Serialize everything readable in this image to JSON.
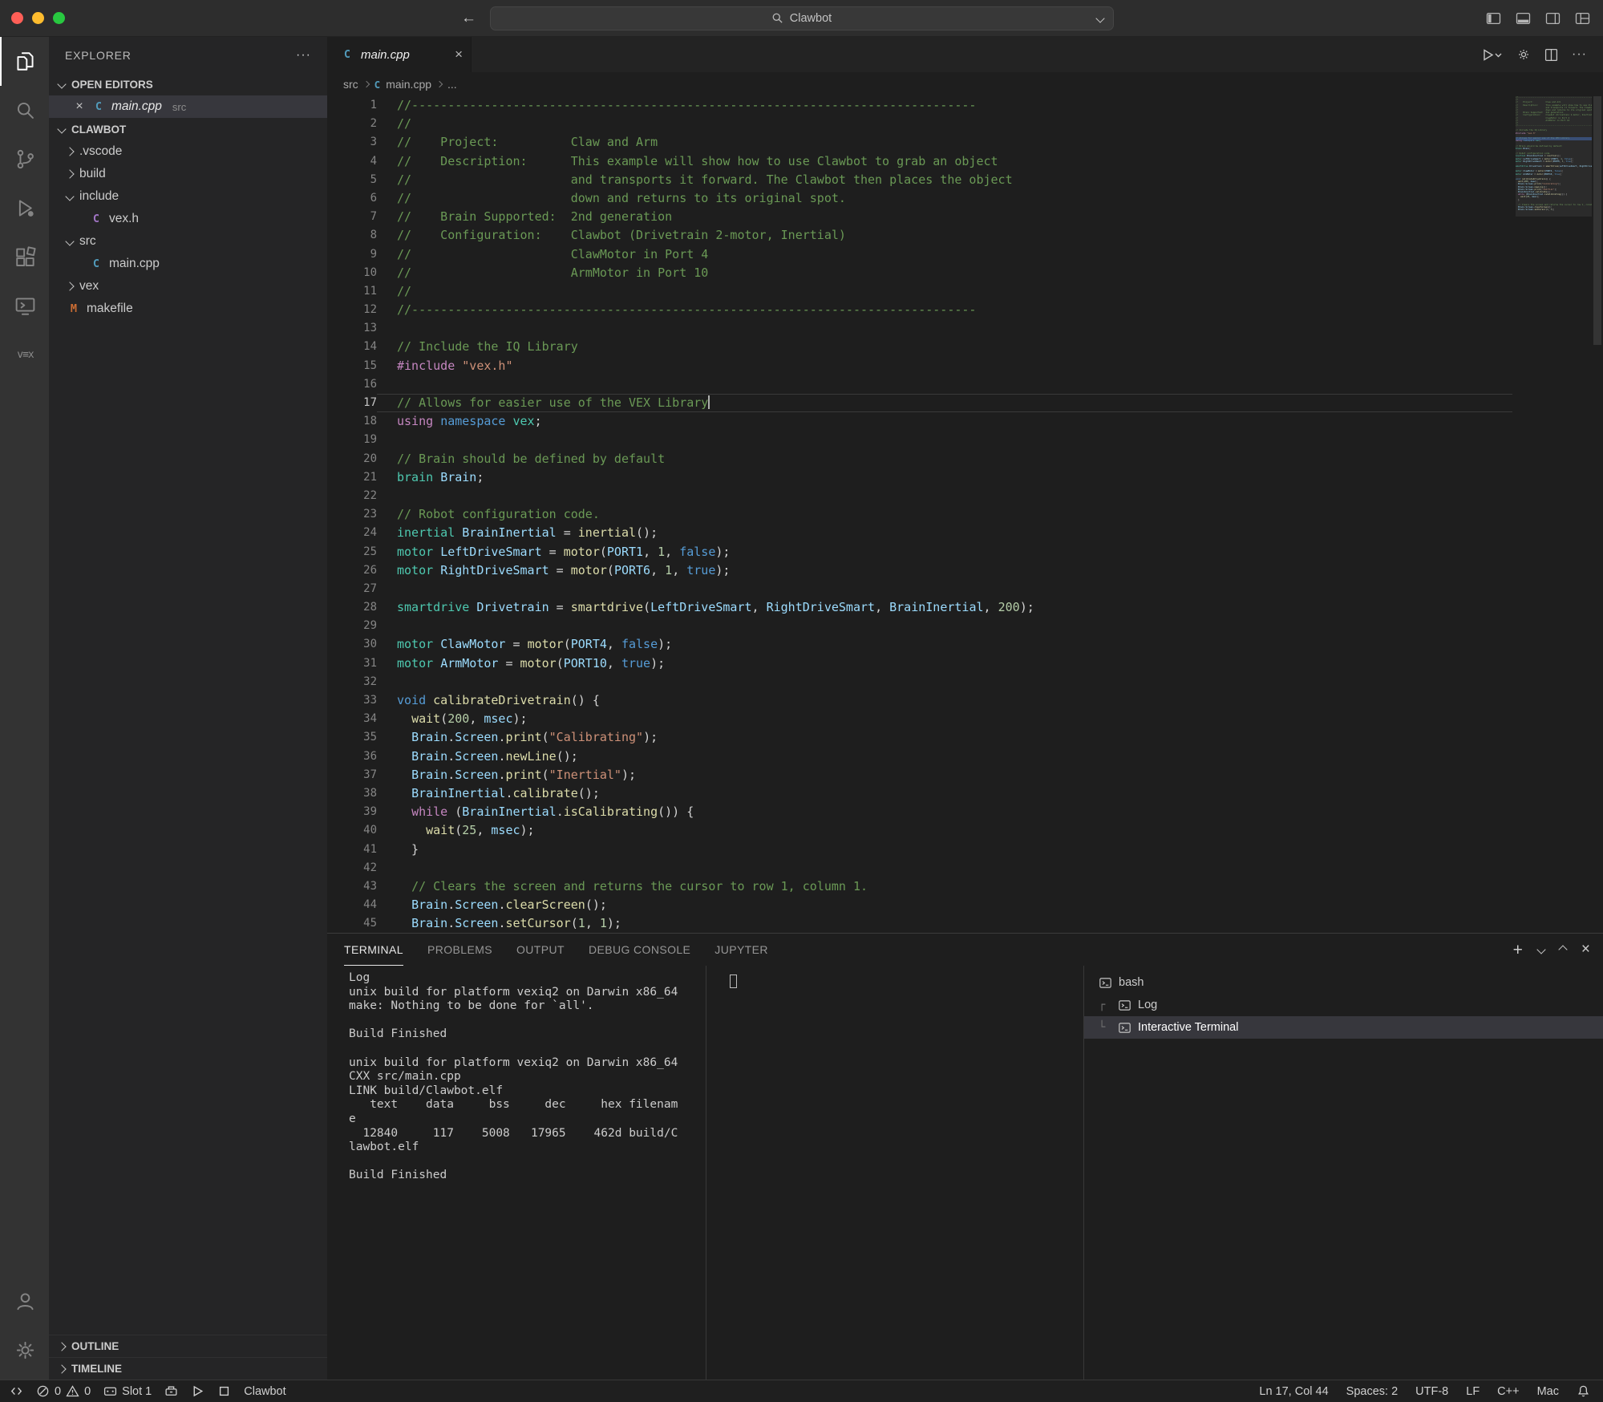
{
  "titlebar": {
    "search_value": "Clawbot",
    "back_glyph": "←",
    "forward_glyph": "→"
  },
  "activity_bar": {
    "top": [
      "explorer",
      "search",
      "source-control",
      "run-debug",
      "extensions",
      "remote-explorer",
      "vex"
    ],
    "bottom": [
      "accounts",
      "settings"
    ],
    "active": "explorer"
  },
  "sidebar": {
    "title": "EXPLORER",
    "open_editors_label": "OPEN EDITORS",
    "open_editor": {
      "file": "main.cpp",
      "path": "src"
    },
    "project_label": "CLAWBOT",
    "tree": [
      {
        "label": ".vscode",
        "depth": 0,
        "chevron": "right",
        "icon": null
      },
      {
        "label": "build",
        "depth": 0,
        "chevron": "right",
        "icon": null
      },
      {
        "label": "include",
        "depth": 0,
        "chevron": "down",
        "icon": null
      },
      {
        "label": "vex.h",
        "depth": 1,
        "chevron": null,
        "icon": "ch"
      },
      {
        "label": "src",
        "depth": 0,
        "chevron": "down",
        "icon": null
      },
      {
        "label": "main.cpp",
        "depth": 1,
        "chevron": null,
        "icon": "cpp"
      },
      {
        "label": "vex",
        "depth": 0,
        "chevron": "right",
        "icon": null
      },
      {
        "label": "makefile",
        "depth": 0,
        "chevron": null,
        "icon": "mk"
      }
    ],
    "outline_label": "OUTLINE",
    "timeline_label": "TIMELINE"
  },
  "editor": {
    "tab_label": "main.cpp",
    "breadcrumb": {
      "folder": "src",
      "file": "main.cpp",
      "more": "..."
    },
    "cursor_line": 17,
    "lines": [
      [
        [
          "c",
          "//------------------------------------------------------------------------------"
        ]
      ],
      [
        [
          "c",
          "//"
        ]
      ],
      [
        [
          "c",
          "//    Project:          Claw and Arm"
        ]
      ],
      [
        [
          "c",
          "//    Description:      This example will show how to use Clawbot to grab an object"
        ]
      ],
      [
        [
          "c",
          "//                      and transports it forward. The Clawbot then places the object"
        ]
      ],
      [
        [
          "c",
          "//                      down and returns to its original spot."
        ]
      ],
      [
        [
          "c",
          "//    Brain Supported:  2nd generation"
        ]
      ],
      [
        [
          "c",
          "//    Configuration:    Clawbot (Drivetrain 2-motor, Inertial)"
        ]
      ],
      [
        [
          "c",
          "//                      ClawMotor in Port 4"
        ]
      ],
      [
        [
          "c",
          "//                      ArmMotor in Port 10"
        ]
      ],
      [
        [
          "c",
          "//"
        ]
      ],
      [
        [
          "c",
          "//------------------------------------------------------------------------------"
        ]
      ],
      [],
      [
        [
          "c",
          "// Include the IQ Library"
        ]
      ],
      [
        [
          "k",
          "#include"
        ],
        [
          "d",
          " "
        ],
        [
          "s",
          "\"vex.h\""
        ]
      ],
      [],
      [
        [
          "c",
          "// Allows for easier use of the VEX Library"
        ]
      ],
      [
        [
          "k",
          "using"
        ],
        [
          "d",
          " "
        ],
        [
          "b",
          "namespace"
        ],
        [
          "d",
          " "
        ],
        [
          "t",
          "vex"
        ],
        [
          "d",
          ";"
        ]
      ],
      [],
      [
        [
          "c",
          "// Brain should be defined by default"
        ]
      ],
      [
        [
          "t",
          "brain"
        ],
        [
          "d",
          " "
        ],
        [
          "v",
          "Brain"
        ],
        [
          "d",
          ";"
        ]
      ],
      [],
      [
        [
          "c",
          "// Robot configuration code."
        ]
      ],
      [
        [
          "t",
          "inertial"
        ],
        [
          "d",
          " "
        ],
        [
          "v",
          "BrainInertial"
        ],
        [
          "d",
          " = "
        ],
        [
          "f",
          "inertial"
        ],
        [
          "d",
          "();"
        ]
      ],
      [
        [
          "t",
          "motor"
        ],
        [
          "d",
          " "
        ],
        [
          "v",
          "LeftDriveSmart"
        ],
        [
          "d",
          " = "
        ],
        [
          "f",
          "motor"
        ],
        [
          "d",
          "("
        ],
        [
          "v",
          "PORT1"
        ],
        [
          "d",
          ", "
        ],
        [
          "n",
          "1"
        ],
        [
          "d",
          ", "
        ],
        [
          "b",
          "false"
        ],
        [
          "d",
          ");"
        ]
      ],
      [
        [
          "t",
          "motor"
        ],
        [
          "d",
          " "
        ],
        [
          "v",
          "RightDriveSmart"
        ],
        [
          "d",
          " = "
        ],
        [
          "f",
          "motor"
        ],
        [
          "d",
          "("
        ],
        [
          "v",
          "PORT6"
        ],
        [
          "d",
          ", "
        ],
        [
          "n",
          "1"
        ],
        [
          "d",
          ", "
        ],
        [
          "b",
          "true"
        ],
        [
          "d",
          ");"
        ]
      ],
      [],
      [
        [
          "t",
          "smartdrive"
        ],
        [
          "d",
          " "
        ],
        [
          "v",
          "Drivetrain"
        ],
        [
          "d",
          " = "
        ],
        [
          "f",
          "smartdrive"
        ],
        [
          "d",
          "("
        ],
        [
          "v",
          "LeftDriveSmart"
        ],
        [
          "d",
          ", "
        ],
        [
          "v",
          "RightDriveSmart"
        ],
        [
          "d",
          ", "
        ],
        [
          "v",
          "BrainInertial"
        ],
        [
          "d",
          ", "
        ],
        [
          "n",
          "200"
        ],
        [
          "d",
          ");"
        ]
      ],
      [],
      [
        [
          "t",
          "motor"
        ],
        [
          "d",
          " "
        ],
        [
          "v",
          "ClawMotor"
        ],
        [
          "d",
          " = "
        ],
        [
          "f",
          "motor"
        ],
        [
          "d",
          "("
        ],
        [
          "v",
          "PORT4"
        ],
        [
          "d",
          ", "
        ],
        [
          "b",
          "false"
        ],
        [
          "d",
          ");"
        ]
      ],
      [
        [
          "t",
          "motor"
        ],
        [
          "d",
          " "
        ],
        [
          "v",
          "ArmMotor"
        ],
        [
          "d",
          " = "
        ],
        [
          "f",
          "motor"
        ],
        [
          "d",
          "("
        ],
        [
          "v",
          "PORT10"
        ],
        [
          "d",
          ", "
        ],
        [
          "b",
          "true"
        ],
        [
          "d",
          ");"
        ]
      ],
      [],
      [
        [
          "b",
          "void"
        ],
        [
          "d",
          " "
        ],
        [
          "f",
          "calibrateDrivetrain"
        ],
        [
          "d",
          "() {"
        ]
      ],
      [
        [
          "d",
          "  "
        ],
        [
          "f",
          "wait"
        ],
        [
          "d",
          "("
        ],
        [
          "n",
          "200"
        ],
        [
          "d",
          ", "
        ],
        [
          "v",
          "msec"
        ],
        [
          "d",
          ");"
        ]
      ],
      [
        [
          "d",
          "  "
        ],
        [
          "v",
          "Brain"
        ],
        [
          "d",
          "."
        ],
        [
          "v",
          "Screen"
        ],
        [
          "d",
          "."
        ],
        [
          "f",
          "print"
        ],
        [
          "d",
          "("
        ],
        [
          "s",
          "\"Calibrating\""
        ],
        [
          "d",
          ");"
        ]
      ],
      [
        [
          "d",
          "  "
        ],
        [
          "v",
          "Brain"
        ],
        [
          "d",
          "."
        ],
        [
          "v",
          "Screen"
        ],
        [
          "d",
          "."
        ],
        [
          "f",
          "newLine"
        ],
        [
          "d",
          "();"
        ]
      ],
      [
        [
          "d",
          "  "
        ],
        [
          "v",
          "Brain"
        ],
        [
          "d",
          "."
        ],
        [
          "v",
          "Screen"
        ],
        [
          "d",
          "."
        ],
        [
          "f",
          "print"
        ],
        [
          "d",
          "("
        ],
        [
          "s",
          "\"Inertial\""
        ],
        [
          "d",
          ");"
        ]
      ],
      [
        [
          "d",
          "  "
        ],
        [
          "v",
          "BrainInertial"
        ],
        [
          "d",
          "."
        ],
        [
          "f",
          "calibrate"
        ],
        [
          "d",
          "();"
        ]
      ],
      [
        [
          "d",
          "  "
        ],
        [
          "k",
          "while"
        ],
        [
          "d",
          " ("
        ],
        [
          "v",
          "BrainInertial"
        ],
        [
          "d",
          "."
        ],
        [
          "f",
          "isCalibrating"
        ],
        [
          "d",
          "()) {"
        ]
      ],
      [
        [
          "d",
          "    "
        ],
        [
          "f",
          "wait"
        ],
        [
          "d",
          "("
        ],
        [
          "n",
          "25"
        ],
        [
          "d",
          ", "
        ],
        [
          "v",
          "msec"
        ],
        [
          "d",
          ");"
        ]
      ],
      [
        [
          "d",
          "  }"
        ]
      ],
      [],
      [
        [
          "d",
          "  "
        ],
        [
          "c",
          "// Clears the screen and returns the cursor to row 1, column 1."
        ]
      ],
      [
        [
          "d",
          "  "
        ],
        [
          "v",
          "Brain"
        ],
        [
          "d",
          "."
        ],
        [
          "v",
          "Screen"
        ],
        [
          "d",
          "."
        ],
        [
          "f",
          "clearScreen"
        ],
        [
          "d",
          "();"
        ]
      ],
      [
        [
          "d",
          "  "
        ],
        [
          "v",
          "Brain"
        ],
        [
          "d",
          "."
        ],
        [
          "v",
          "Screen"
        ],
        [
          "d",
          "."
        ],
        [
          "f",
          "setCursor"
        ],
        [
          "d",
          "("
        ],
        [
          "n",
          "1"
        ],
        [
          "d",
          ", "
        ],
        [
          "n",
          "1"
        ],
        [
          "d",
          ");"
        ]
      ]
    ]
  },
  "panel": {
    "tabs": [
      {
        "label": "TERMINAL",
        "active": true
      },
      {
        "label": "PROBLEMS",
        "active": false
      },
      {
        "label": "OUTPUT",
        "active": false
      },
      {
        "label": "DEBUG CONSOLE",
        "active": false
      },
      {
        "label": "JUPYTER",
        "active": false
      }
    ],
    "terminal_output": [
      "Log",
      "unix build for platform vexiq2 on Darwin x86_64",
      "make: Nothing to be done for `all'.",
      "",
      "Build Finished",
      "",
      "unix build for platform vexiq2 on Darwin x86_64",
      "CXX src/main.cpp",
      "LINK build/Clawbot.elf",
      "   text    data     bss     dec     hex filenam",
      "e",
      "  12840     117    5008   17965    462d build/C",
      "lawbot.elf",
      "",
      "Build Finished"
    ],
    "terminal_list": [
      {
        "label": "bash",
        "connector": "",
        "selected": false
      },
      {
        "label": "Log",
        "connector": "┌",
        "selected": false
      },
      {
        "label": "Interactive Terminal",
        "connector": "└",
        "selected": true
      }
    ]
  },
  "status_bar": {
    "errors": "0",
    "warnings": "0",
    "slot": "Slot 1",
    "project": "Clawbot",
    "line_col": "Ln 17, Col 44",
    "indentation": "Spaces: 2",
    "encoding": "UTF-8",
    "eol": "LF",
    "language": "C++",
    "platform": "Mac"
  }
}
